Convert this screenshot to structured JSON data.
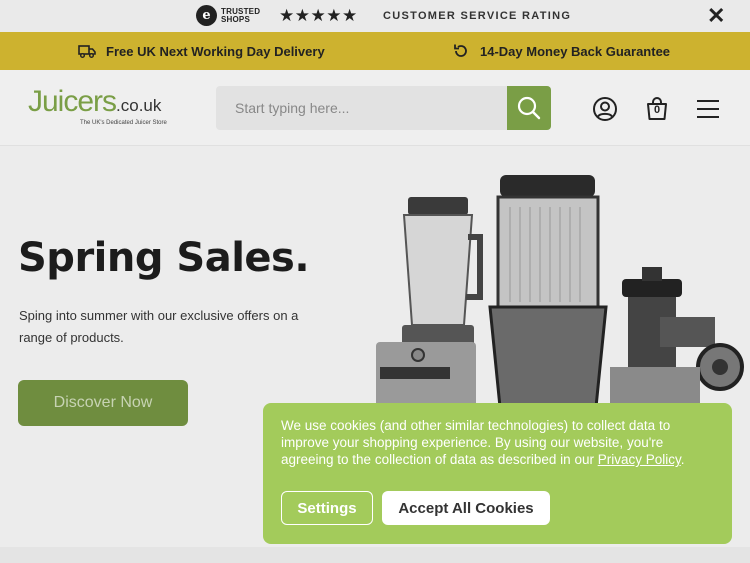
{
  "trust_bar": {
    "logo_line1": "TRUSTED",
    "logo_line2": "SHOPS",
    "logo_glyph": "e",
    "stars": "★★★★★",
    "rating_label": "CUSTOMER SERVICE RATING",
    "close_icon": "✕"
  },
  "delivery_bar": {
    "delivery_text": "Free UK Next Working Day Delivery",
    "guarantee_text": "14-Day Money Back Guarantee",
    "delivery_icon": "truck-icon",
    "guarantee_icon": "refresh-icon",
    "bg_color": "#cdb22f"
  },
  "header": {
    "logo_name": "Juicers",
    "logo_tld": ".co.uk",
    "logo_tagline": "The UK's Dedicated Juicer Store",
    "search_placeholder": "Start typing here...",
    "basket_count": "0",
    "brand_color": "#7a9e46"
  },
  "hero": {
    "title": "Spring Sales.",
    "text": "Sping into summer with our exclusive offers on a range of products.",
    "button_label": "Discover Now"
  },
  "cookie_banner": {
    "text_before_link": "We use cookies (and other similar technologies) to collect data to improve your shopping experience. By using our website, you're agreeing to the collection of data as described in our ",
    "link_text": "Privacy Policy",
    "text_after_link": ".",
    "settings_label": "Settings",
    "accept_label": "Accept All Cookies",
    "bg_color": "#a3cb5b"
  }
}
